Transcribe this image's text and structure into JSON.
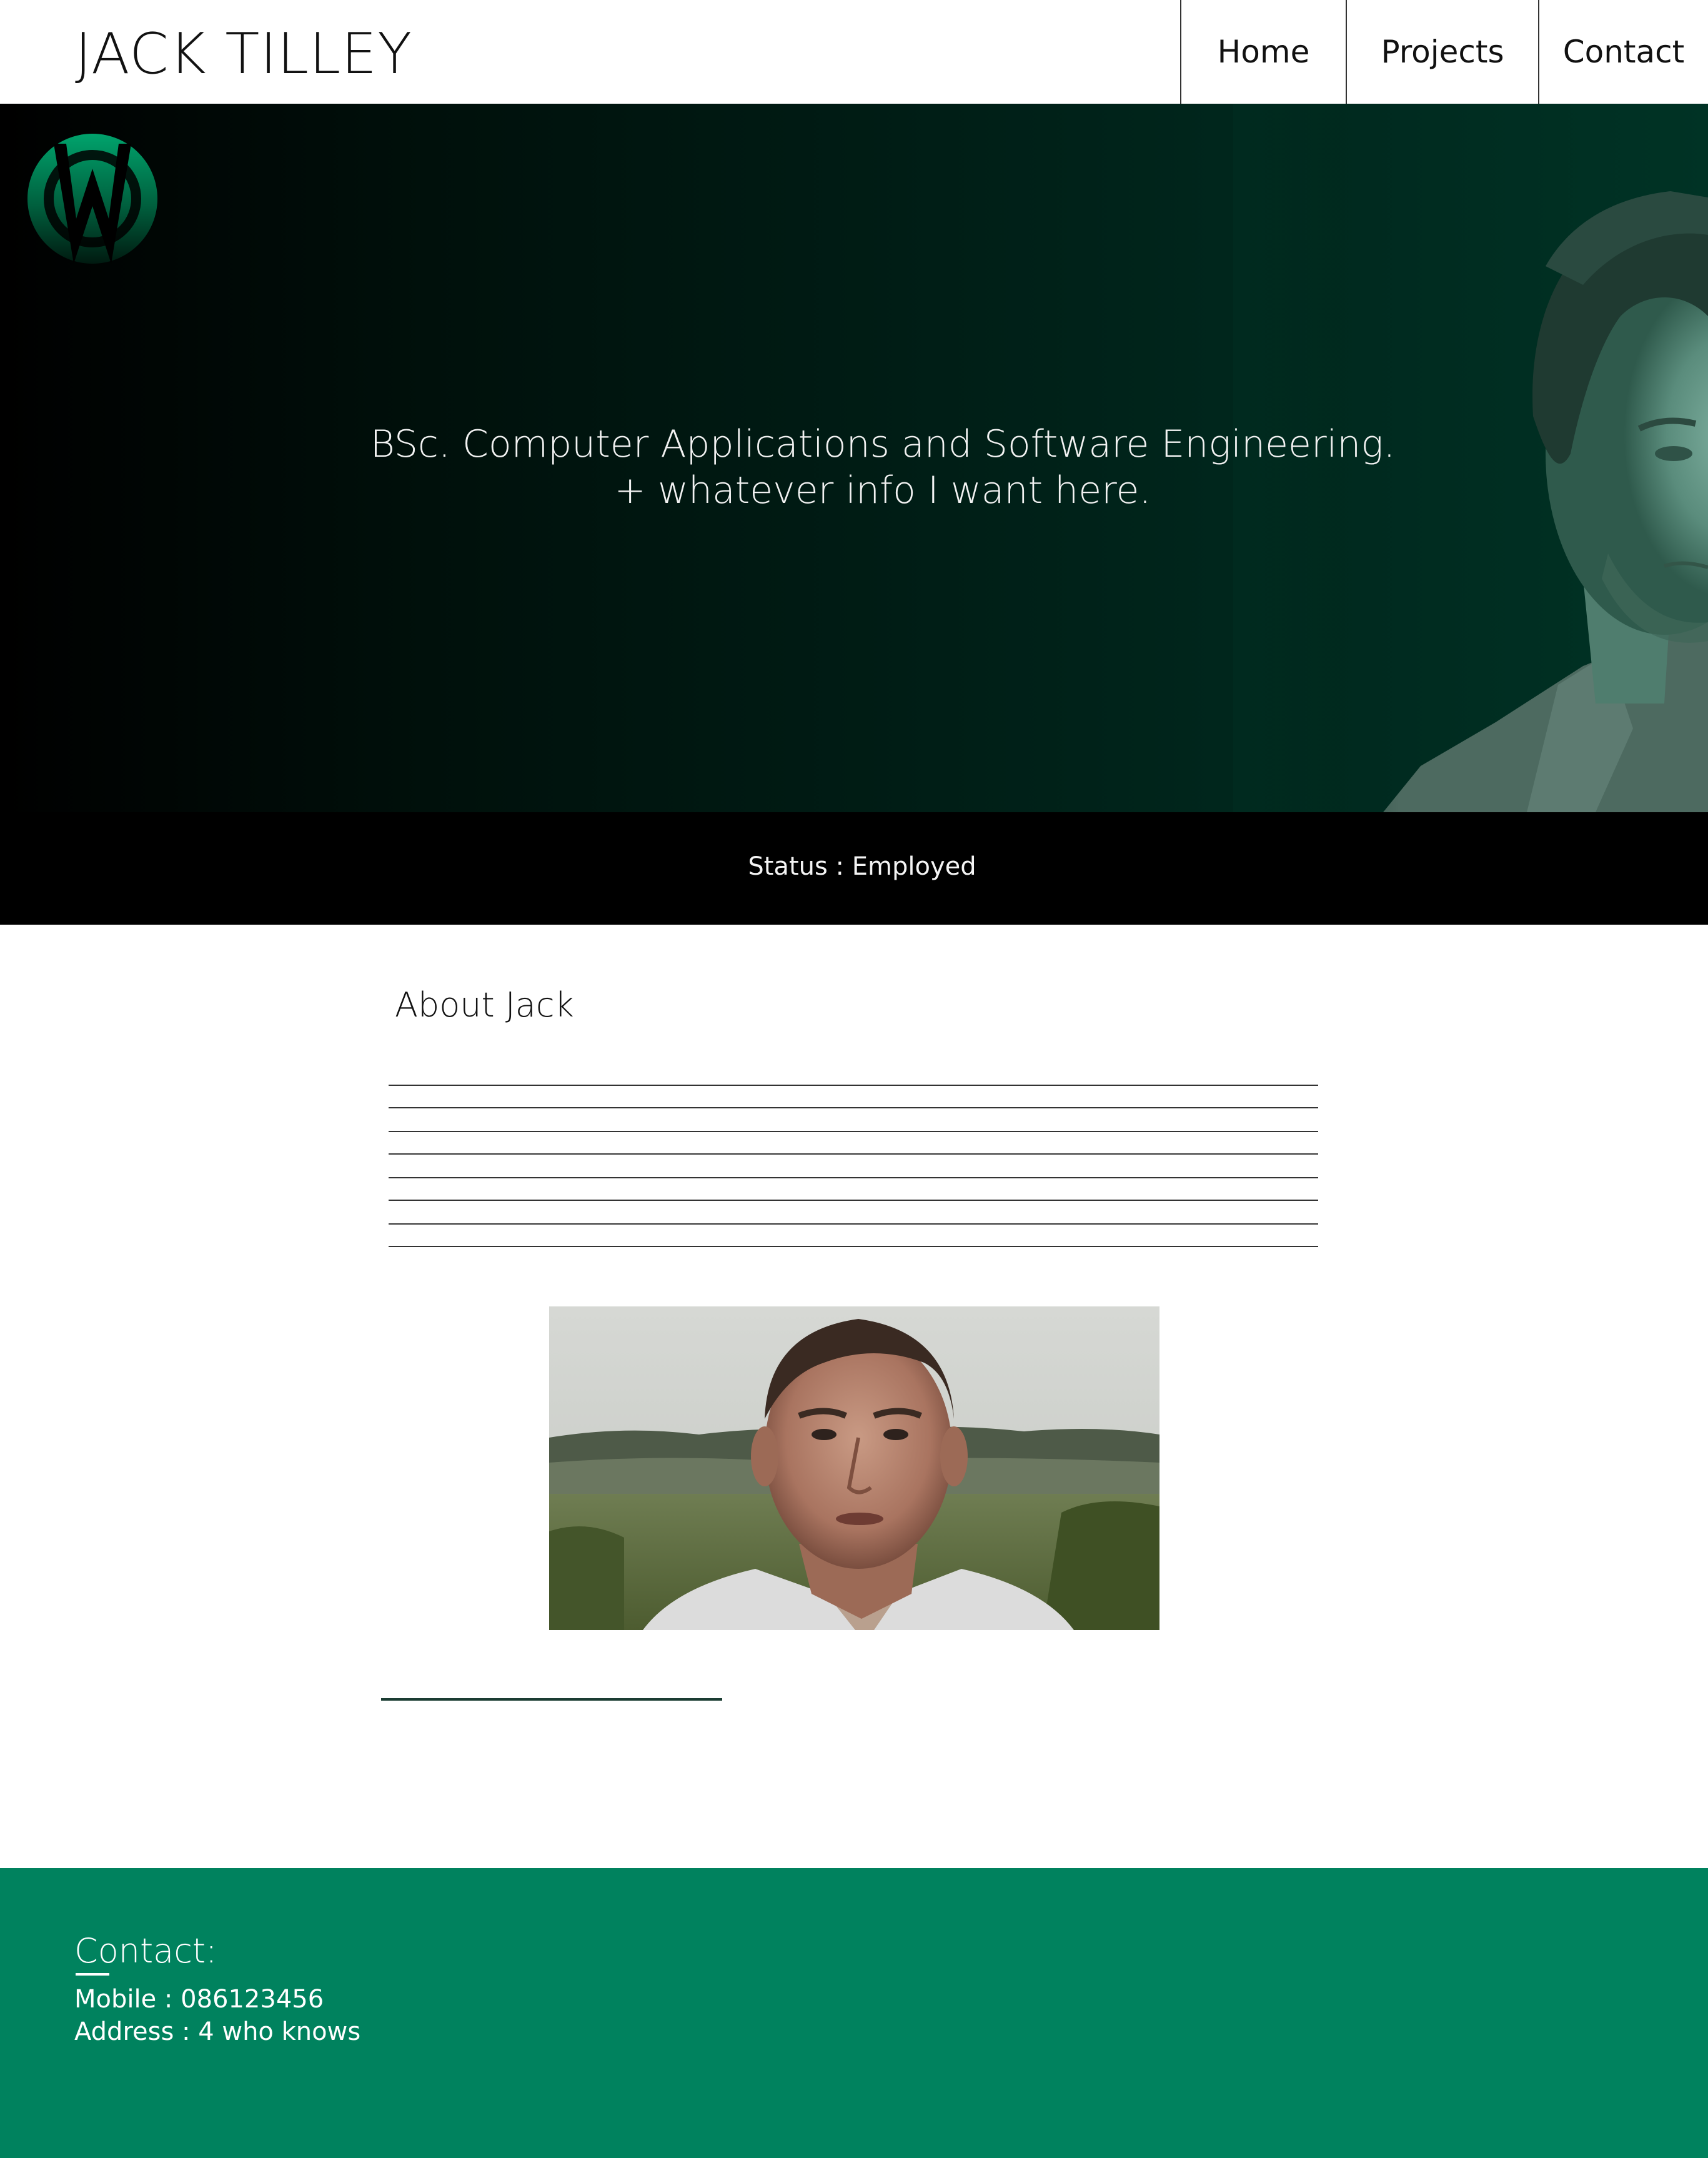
{
  "header": {
    "site_title": "JACK TILLEY",
    "nav": [
      "Home",
      "Projects",
      "Contact"
    ]
  },
  "hero": {
    "line1": "BSc. Computer Applications and Software Engineering.",
    "line2": "+ whatever info I want here.",
    "logo_icon": "w-logo-icon",
    "portrait_image": "profile-portrait",
    "colors": {
      "hero_dark": "#000000",
      "hero_green": "#003325",
      "logo_green": "#00a36c"
    }
  },
  "status": {
    "text": "Status : Employed"
  },
  "about": {
    "title": "About Jack",
    "line_count": 8,
    "photo": "about-photo"
  },
  "footer": {
    "heading": "Contact:",
    "mobile": "Mobile : 086123456",
    "address": "Address : 4 who knows",
    "colors": {
      "background": "#00825e",
      "text": "#ffffff"
    }
  }
}
